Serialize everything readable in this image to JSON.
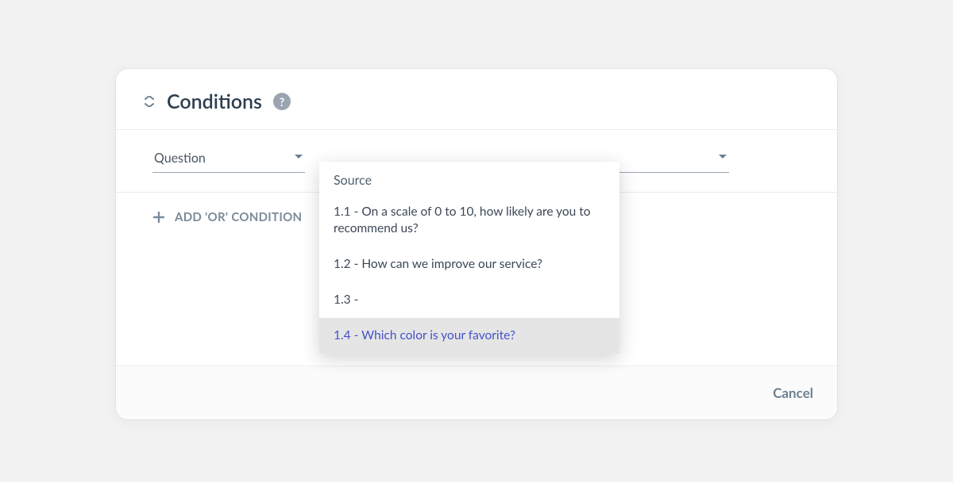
{
  "header": {
    "title": "Conditions",
    "help_tooltip": "?"
  },
  "condition_row": {
    "question_select": {
      "value": "Question"
    },
    "source_select": {
      "group_label": "Source",
      "options": [
        {
          "label": "1.1 - On a scale of 0 to 10, how likely are you to recommend us?",
          "selected": false
        },
        {
          "label": "1.2 - How can we improve our service?",
          "selected": false
        },
        {
          "label": "1.3 -",
          "selected": false
        },
        {
          "label": "1.4 - Which color is your favorite?",
          "selected": true
        }
      ]
    }
  },
  "add_or": {
    "label": "ADD 'OR' CONDITION"
  },
  "footer": {
    "cancel": "Cancel"
  }
}
